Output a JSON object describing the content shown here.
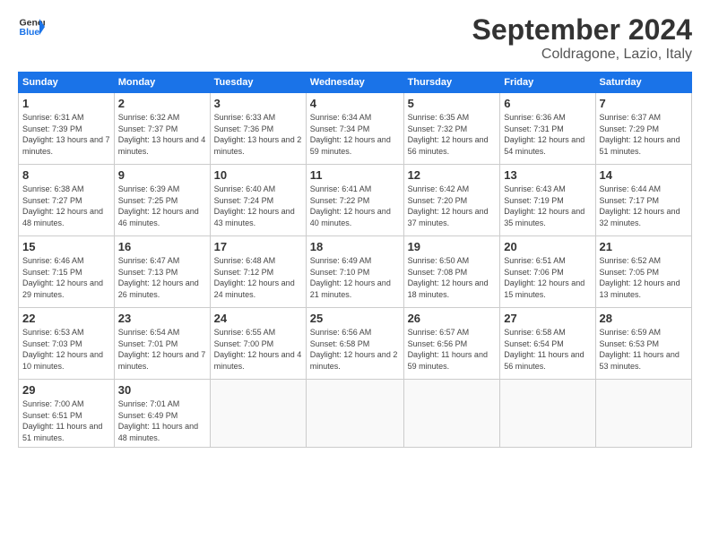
{
  "header": {
    "logo_line1": "General",
    "logo_line2": "Blue",
    "month": "September 2024",
    "location": "Coldragone, Lazio, Italy"
  },
  "weekdays": [
    "Sunday",
    "Monday",
    "Tuesday",
    "Wednesday",
    "Thursday",
    "Friday",
    "Saturday"
  ],
  "weeks": [
    [
      {
        "day": "1",
        "sunrise": "6:31 AM",
        "sunset": "7:39 PM",
        "daylight": "13 hours and 7 minutes."
      },
      {
        "day": "2",
        "sunrise": "6:32 AM",
        "sunset": "7:37 PM",
        "daylight": "13 hours and 4 minutes."
      },
      {
        "day": "3",
        "sunrise": "6:33 AM",
        "sunset": "7:36 PM",
        "daylight": "13 hours and 2 minutes."
      },
      {
        "day": "4",
        "sunrise": "6:34 AM",
        "sunset": "7:34 PM",
        "daylight": "12 hours and 59 minutes."
      },
      {
        "day": "5",
        "sunrise": "6:35 AM",
        "sunset": "7:32 PM",
        "daylight": "12 hours and 56 minutes."
      },
      {
        "day": "6",
        "sunrise": "6:36 AM",
        "sunset": "7:31 PM",
        "daylight": "12 hours and 54 minutes."
      },
      {
        "day": "7",
        "sunrise": "6:37 AM",
        "sunset": "7:29 PM",
        "daylight": "12 hours and 51 minutes."
      }
    ],
    [
      {
        "day": "8",
        "sunrise": "6:38 AM",
        "sunset": "7:27 PM",
        "daylight": "12 hours and 48 minutes."
      },
      {
        "day": "9",
        "sunrise": "6:39 AM",
        "sunset": "7:25 PM",
        "daylight": "12 hours and 46 minutes."
      },
      {
        "day": "10",
        "sunrise": "6:40 AM",
        "sunset": "7:24 PM",
        "daylight": "12 hours and 43 minutes."
      },
      {
        "day": "11",
        "sunrise": "6:41 AM",
        "sunset": "7:22 PM",
        "daylight": "12 hours and 40 minutes."
      },
      {
        "day": "12",
        "sunrise": "6:42 AM",
        "sunset": "7:20 PM",
        "daylight": "12 hours and 37 minutes."
      },
      {
        "day": "13",
        "sunrise": "6:43 AM",
        "sunset": "7:19 PM",
        "daylight": "12 hours and 35 minutes."
      },
      {
        "day": "14",
        "sunrise": "6:44 AM",
        "sunset": "7:17 PM",
        "daylight": "12 hours and 32 minutes."
      }
    ],
    [
      {
        "day": "15",
        "sunrise": "6:46 AM",
        "sunset": "7:15 PM",
        "daylight": "12 hours and 29 minutes."
      },
      {
        "day": "16",
        "sunrise": "6:47 AM",
        "sunset": "7:13 PM",
        "daylight": "12 hours and 26 minutes."
      },
      {
        "day": "17",
        "sunrise": "6:48 AM",
        "sunset": "7:12 PM",
        "daylight": "12 hours and 24 minutes."
      },
      {
        "day": "18",
        "sunrise": "6:49 AM",
        "sunset": "7:10 PM",
        "daylight": "12 hours and 21 minutes."
      },
      {
        "day": "19",
        "sunrise": "6:50 AM",
        "sunset": "7:08 PM",
        "daylight": "12 hours and 18 minutes."
      },
      {
        "day": "20",
        "sunrise": "6:51 AM",
        "sunset": "7:06 PM",
        "daylight": "12 hours and 15 minutes."
      },
      {
        "day": "21",
        "sunrise": "6:52 AM",
        "sunset": "7:05 PM",
        "daylight": "12 hours and 13 minutes."
      }
    ],
    [
      {
        "day": "22",
        "sunrise": "6:53 AM",
        "sunset": "7:03 PM",
        "daylight": "12 hours and 10 minutes."
      },
      {
        "day": "23",
        "sunrise": "6:54 AM",
        "sunset": "7:01 PM",
        "daylight": "12 hours and 7 minutes."
      },
      {
        "day": "24",
        "sunrise": "6:55 AM",
        "sunset": "7:00 PM",
        "daylight": "12 hours and 4 minutes."
      },
      {
        "day": "25",
        "sunrise": "6:56 AM",
        "sunset": "6:58 PM",
        "daylight": "12 hours and 2 minutes."
      },
      {
        "day": "26",
        "sunrise": "6:57 AM",
        "sunset": "6:56 PM",
        "daylight": "11 hours and 59 minutes."
      },
      {
        "day": "27",
        "sunrise": "6:58 AM",
        "sunset": "6:54 PM",
        "daylight": "11 hours and 56 minutes."
      },
      {
        "day": "28",
        "sunrise": "6:59 AM",
        "sunset": "6:53 PM",
        "daylight": "11 hours and 53 minutes."
      }
    ],
    [
      {
        "day": "29",
        "sunrise": "7:00 AM",
        "sunset": "6:51 PM",
        "daylight": "11 hours and 51 minutes."
      },
      {
        "day": "30",
        "sunrise": "7:01 AM",
        "sunset": "6:49 PM",
        "daylight": "11 hours and 48 minutes."
      },
      null,
      null,
      null,
      null,
      null
    ]
  ]
}
